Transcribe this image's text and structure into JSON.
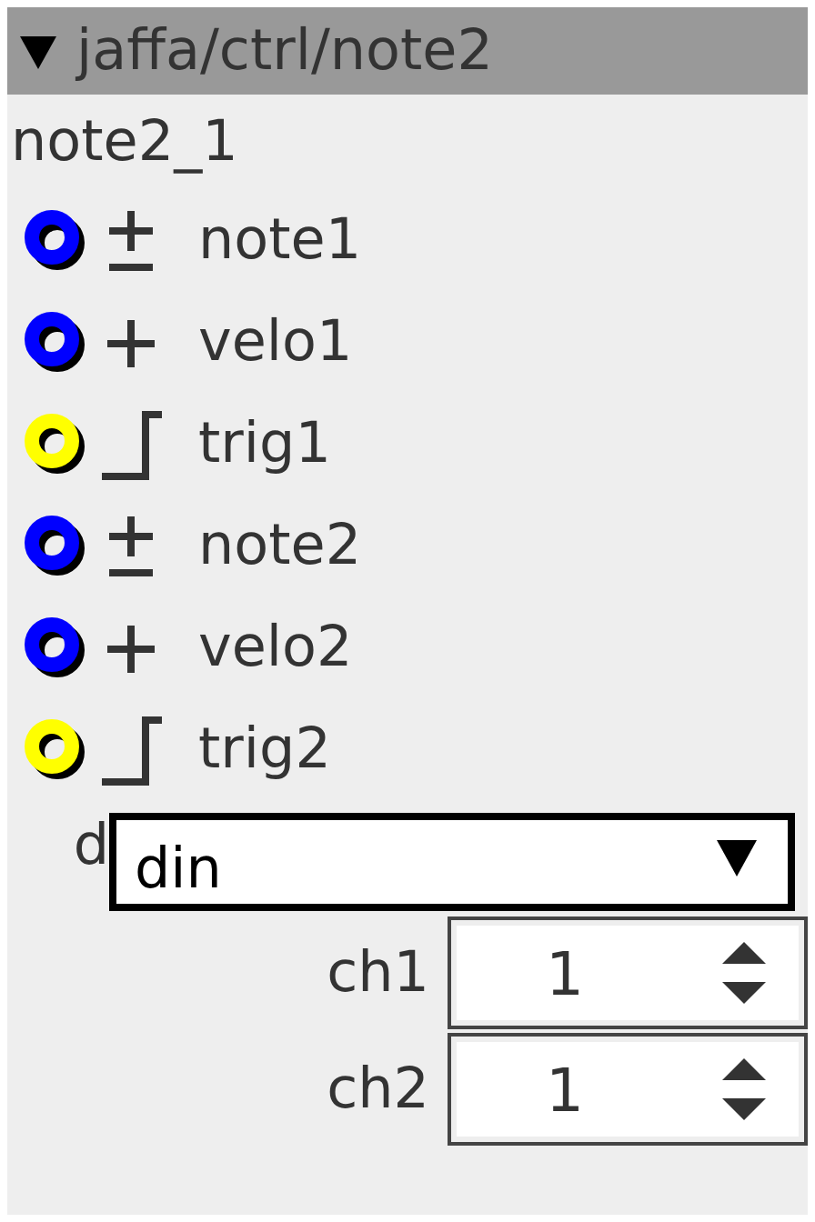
{
  "panel": {
    "title": "jaffa/ctrl/note2",
    "expanded": true
  },
  "node": {
    "name": "note2_1"
  },
  "ports": [
    {
      "name": "note1",
      "kind": "note",
      "color": "#0000ff"
    },
    {
      "name": "velo1",
      "kind": "velocity",
      "color": "#0000ff"
    },
    {
      "name": "trig1",
      "kind": "trigger",
      "color": "#ffff00"
    },
    {
      "name": "note2",
      "kind": "note",
      "color": "#0000ff"
    },
    {
      "name": "velo2",
      "kind": "velocity",
      "color": "#0000ff"
    },
    {
      "name": "trig2",
      "kind": "trigger",
      "color": "#ffff00"
    }
  ],
  "dropdown": {
    "label": "d",
    "value": "din"
  },
  "spinboxes": [
    {
      "label": "ch1",
      "value": "1"
    },
    {
      "label": "ch2",
      "value": "1"
    }
  ]
}
